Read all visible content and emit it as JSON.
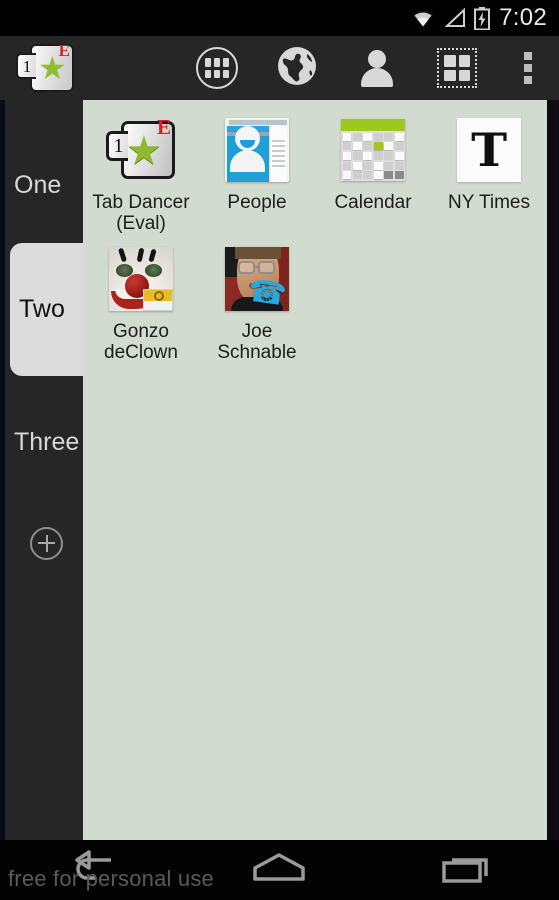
{
  "status_bar": {
    "time": "7:02",
    "icons": [
      "wifi-icon",
      "signal-icon",
      "battery-charging-icon"
    ]
  },
  "action_bar": {
    "app_logo": {
      "name": "tab-dancer-logo",
      "badge_number": "1",
      "badge_eval": "E",
      "star": "★"
    },
    "buttons": [
      {
        "name": "all-apps-button",
        "icon": "apps-grid-circle-icon"
      },
      {
        "name": "browser-button",
        "icon": "globe-icon"
      },
      {
        "name": "contacts-button",
        "icon": "person-icon"
      },
      {
        "name": "widgets-button",
        "icon": "widgets-grid-icon"
      },
      {
        "name": "overflow-button",
        "icon": "overflow-dots-icon"
      }
    ]
  },
  "sidebar": {
    "tabs": [
      {
        "label": "One",
        "selected": false
      },
      {
        "label": "Two",
        "selected": true
      },
      {
        "label": "Three",
        "selected": false
      }
    ],
    "add_tab": {
      "label": "+",
      "icon": "add-circle-icon"
    }
  },
  "content": {
    "background_color": "#d2dbd0",
    "items": [
      {
        "label": "Tab Dancer\n(Eval)",
        "label_line1": "Tab Dancer",
        "label_line2": "(Eval)",
        "icon": "tab-dancer-icon"
      },
      {
        "label": "People",
        "label_line1": "People",
        "label_line2": "",
        "icon": "people-icon"
      },
      {
        "label": "Calendar",
        "label_line1": "Calendar",
        "label_line2": "",
        "icon": "calendar-icon"
      },
      {
        "label": "NY Times",
        "label_line1": "NY Times",
        "label_line2": "",
        "icon": "nytimes-icon",
        "glyph": "T"
      },
      {
        "label": "Gonzo deClown",
        "label_line1": "Gonzo",
        "label_line2": "deClown",
        "icon": "clown-contact-icon"
      },
      {
        "label": "Joe Schnable",
        "label_line1": "Joe",
        "label_line2": "Schnable",
        "icon": "joe-contact-icon"
      }
    ]
  },
  "nav_bar": {
    "buttons": [
      {
        "name": "back-button",
        "icon": "back-arrow-icon"
      },
      {
        "name": "home-button",
        "icon": "home-icon"
      },
      {
        "name": "recents-button",
        "icon": "recents-icon"
      }
    ]
  },
  "watermark": {
    "text": "free for personal use"
  },
  "colors": {
    "accent_green": "#8cbb30",
    "content_bg": "#d2dbd0",
    "chrome_dark": "#262626",
    "tab_selected": "#dcdcdc"
  }
}
